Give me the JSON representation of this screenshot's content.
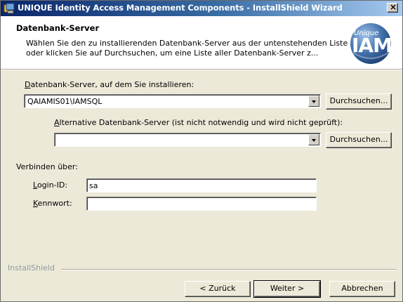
{
  "window": {
    "title": "UNIQUE Identity Access Management Components - InstallShield Wizard",
    "close_glyph": "×"
  },
  "header": {
    "title": "Datenbank-Server",
    "description": "Wählen Sie den zu installierenden Datenbank-Server aus der untenstehenden Liste oder klicken Sie auf Durchsuchen, um eine Liste aller Datenbank-Server z...",
    "logo_small": "Unique",
    "logo_big": "IAM",
    "logo_color": "#3f6ea8"
  },
  "server": {
    "label_prefix": "D",
    "label_rest": "atenbank-Server, auf dem Sie installieren:",
    "value": "QAIAMIS01\\IAMSQL",
    "browse_label": "Durchsuchen..."
  },
  "alt_server": {
    "label_prefix": "A",
    "label_rest": "lternative Datenbank-Server (ist nicht notwendig und wird nicht geprüft):",
    "value": "",
    "browse_label": "Durchsuchen..."
  },
  "connect": {
    "label": "Verbinden über:",
    "login_prefix": "L",
    "login_rest": "ogin-ID:",
    "login_value": "sa",
    "password_prefix": "K",
    "password_rest": "ennwort:",
    "password_value": ""
  },
  "footer": {
    "brand": "InstallShield",
    "back_label": "< Zurück",
    "next_label": "Weiter >",
    "cancel_label": "Abbrechen"
  }
}
